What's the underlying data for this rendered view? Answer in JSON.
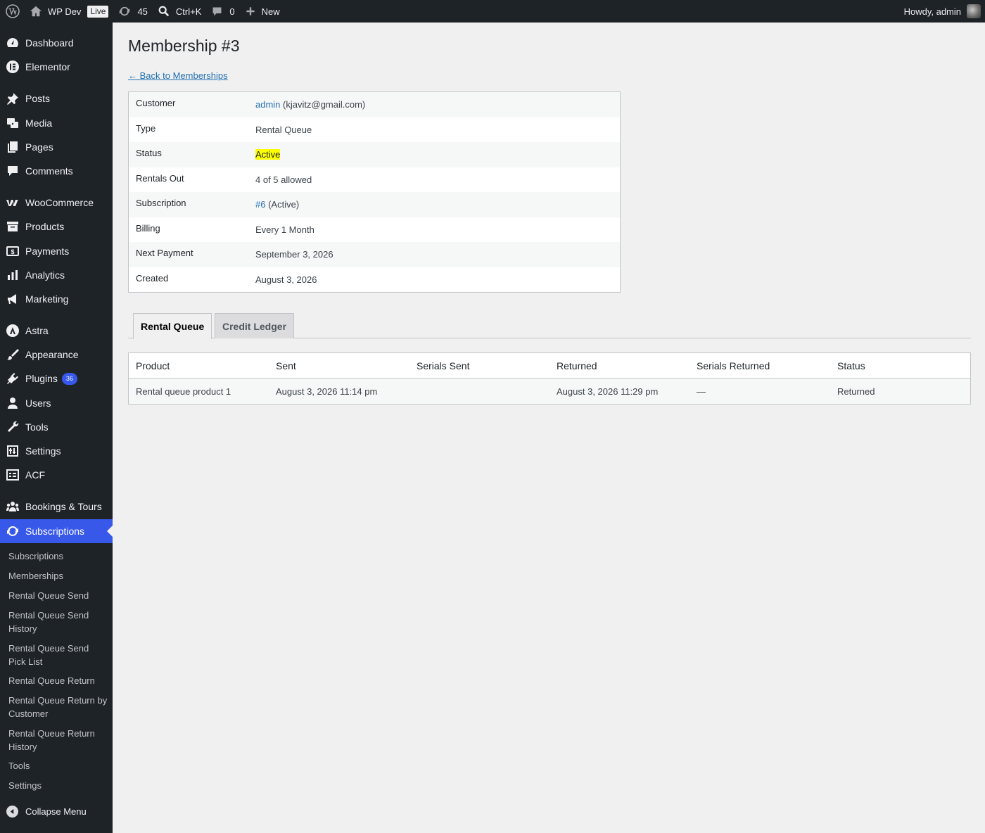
{
  "adminbar": {
    "site_name": "WP Dev",
    "live_badge": "Live",
    "updates_count": "45",
    "search_shortcut": "Ctrl+K",
    "comments_count": "0",
    "new_label": "New",
    "howdy": "Howdy, admin"
  },
  "sidebar": {
    "items": [
      {
        "label": "Dashboard",
        "icon": "dashboard-icon"
      },
      {
        "label": "Elementor",
        "icon": "elementor-icon"
      },
      {
        "label": "Posts",
        "icon": "pushpin-icon"
      },
      {
        "label": "Media",
        "icon": "media-icon"
      },
      {
        "label": "Pages",
        "icon": "pages-icon"
      },
      {
        "label": "Comments",
        "icon": "comment-icon"
      },
      {
        "label": "WooCommerce",
        "icon": "woocommerce-icon"
      },
      {
        "label": "Products",
        "icon": "archive-icon"
      },
      {
        "label": "Payments",
        "icon": "payments-icon"
      },
      {
        "label": "Analytics",
        "icon": "bar-chart-icon"
      },
      {
        "label": "Marketing",
        "icon": "megaphone-icon"
      },
      {
        "label": "Astra",
        "icon": "astra-icon"
      },
      {
        "label": "Appearance",
        "icon": "brush-icon"
      },
      {
        "label": "Plugins",
        "icon": "plugin-icon",
        "badge": "36"
      },
      {
        "label": "Users",
        "icon": "user-icon"
      },
      {
        "label": "Tools",
        "icon": "wrench-icon"
      },
      {
        "label": "Settings",
        "icon": "sliders-icon"
      },
      {
        "label": "ACF",
        "icon": "acf-icon"
      },
      {
        "label": "Bookings & Tours",
        "icon": "groups-icon"
      },
      {
        "label": "Subscriptions",
        "icon": "subscriptions-icon"
      }
    ],
    "submenu": [
      "Subscriptions",
      "Memberships",
      "Rental Queue Send",
      "Rental Queue Send History",
      "Rental Queue Send Pick List",
      "Rental Queue Return",
      "Rental Queue Return by Customer",
      "Rental Queue Return History",
      "Tools",
      "Settings"
    ],
    "collapse_label": "Collapse Menu"
  },
  "main": {
    "title": "Membership #3",
    "back_link": "← Back to Memberships",
    "details": {
      "customer_label": "Customer",
      "customer_link": "admin",
      "customer_email": "(kjavitz@gmail.com)",
      "type_label": "Type",
      "type_value": "Rental Queue",
      "status_label": "Status",
      "status_value": "Active",
      "rentals_label": "Rentals Out",
      "rentals_value": "4 of 5 allowed",
      "subscription_label": "Subscription",
      "subscription_link": "#6",
      "subscription_status": "(Active)",
      "billing_label": "Billing",
      "billing_value": "Every 1 Month",
      "next_payment_label": "Next Payment",
      "next_payment_value": "September 3, 2026",
      "created_label": "Created",
      "created_value": "August 3, 2026"
    },
    "tabs": [
      "Rental Queue",
      "Credit Ledger"
    ],
    "queue_table": {
      "headers": [
        "Product",
        "Sent",
        "Serials Sent",
        "Returned",
        "Serials Returned",
        "Status"
      ],
      "rows": [
        [
          "Rental queue product 1",
          "August 3, 2026 11:14 pm",
          "",
          "August 3, 2026 11:29 pm",
          "—",
          "Returned"
        ]
      ]
    }
  }
}
